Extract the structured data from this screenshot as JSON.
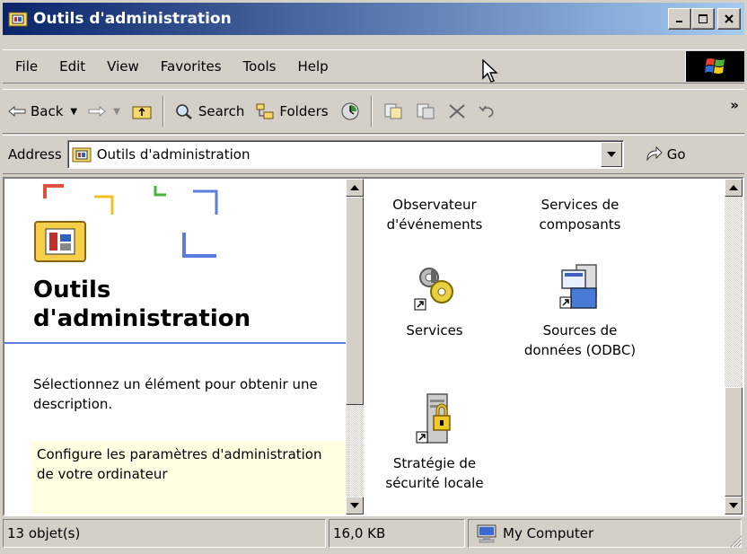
{
  "window": {
    "title": "Outils d'administration"
  },
  "menu": [
    "File",
    "Edit",
    "View",
    "Favorites",
    "Tools",
    "Help"
  ],
  "toolbar": {
    "back": "Back",
    "search": "Search",
    "folders": "Folders",
    "more": "»"
  },
  "address": {
    "label": "Address",
    "value": "Outils d'administration",
    "go": "Go"
  },
  "left_pane": {
    "title_line1": "Outils",
    "title_line2": "d'administration",
    "description": "Sélectionnez un élément pour obtenir une description.",
    "info": "Configure les paramètres d'administration de votre ordinateur"
  },
  "items": [
    {
      "icon": "event-viewer-icon",
      "line1": "Observateur",
      "line2": "d'événements"
    },
    {
      "icon": "component-services-icon",
      "line1": "Services de",
      "line2": "composants"
    },
    {
      "icon": "services-gear-icon",
      "line1": "Services",
      "line2": ""
    },
    {
      "icon": "odbc-data-sources-icon",
      "line1": "Sources de",
      "line2": "données (ODBC)"
    },
    {
      "icon": "local-security-policy-icon",
      "line1": "Stratégie de",
      "line2": "sécurité locale"
    }
  ],
  "status": {
    "objects": "13 objet(s)",
    "size": "16,0 KB",
    "zone": "My Computer"
  }
}
